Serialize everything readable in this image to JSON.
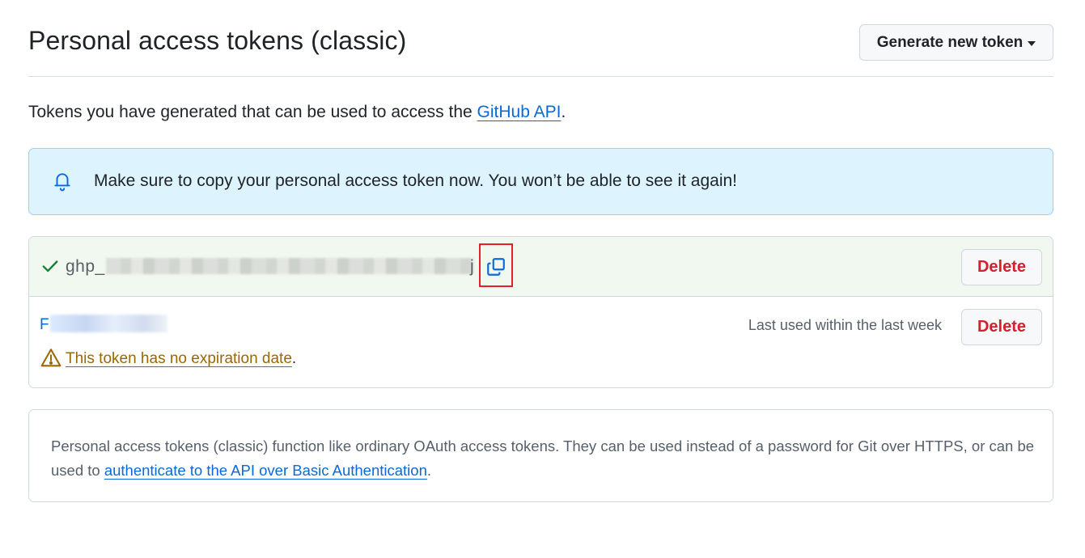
{
  "header": {
    "title": "Personal access tokens (classic)",
    "generate_button_label": "Generate new token"
  },
  "intro": {
    "text": "Tokens you have generated that can be used to access the ",
    "link_text": "GitHub API",
    "suffix": "."
  },
  "flash": {
    "icon": "bell-icon",
    "message": "Make sure to copy your personal access token now. You won’t be able to see it again!"
  },
  "tokens": {
    "new_token": {
      "status_icon": "check-icon",
      "value_prefix": "ghp_",
      "value_end": "j",
      "copy_icon": "copy-icon",
      "delete_label": "Delete"
    },
    "existing_token": {
      "name_visible_start": "F",
      "last_used": "Last used within the last week",
      "delete_label": "Delete",
      "warning_icon": "alert-icon",
      "warning_link": "This token has no expiration date",
      "warning_suffix": "."
    }
  },
  "info": {
    "text": "Personal access tokens (classic) function like ordinary OAuth access tokens. They can be used instead of a password for Git over HTTPS, or can be used to ",
    "link_text": "authenticate to the API over Basic Authentication",
    "suffix": "."
  },
  "colors": {
    "accent": "#0969da",
    "danger": "#cf222e",
    "success": "#1a7f37",
    "warning": "#9a6700",
    "flash_bg": "#ddf4ff",
    "highlight": "#e5222b"
  }
}
